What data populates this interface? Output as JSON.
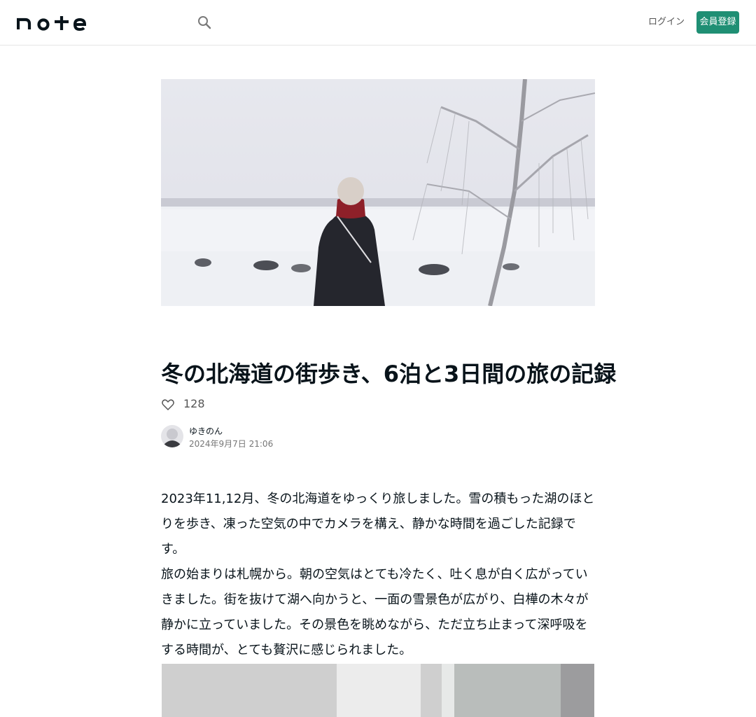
{
  "header": {
    "logo_text": "note",
    "search_icon": "search-icon",
    "login_label": "ログイン",
    "signup_label": "会員登録"
  },
  "article": {
    "title": "冬の北海道の街歩き、6泊と3日間の旅の記録",
    "likes": "128",
    "author": "ゆきのん",
    "date": "2024年9月7日 21:06",
    "paragraphs": [
      "2023年11,12月、冬の北海道をゆっくり旅しました。雪の積もった湖のほとりを歩き、凍った空気の中でカメラを構え、静かな時間を過ごした記録です。",
      "旅の始まりは札幌から。朝の空気はとても冷たく、吐く息が白く広がっていきました。街を抜けて湖へ向かうと、一面の雪景色が広がり、白樺の木々が静かに立っていました。その景色を眺めながら、ただ立ち止まって深呼吸をする時間が、とても贅沢に感じられました。"
    ]
  },
  "colors": {
    "brand": "#1f8f74",
    "text": "#08131a",
    "muted": "#767676"
  }
}
